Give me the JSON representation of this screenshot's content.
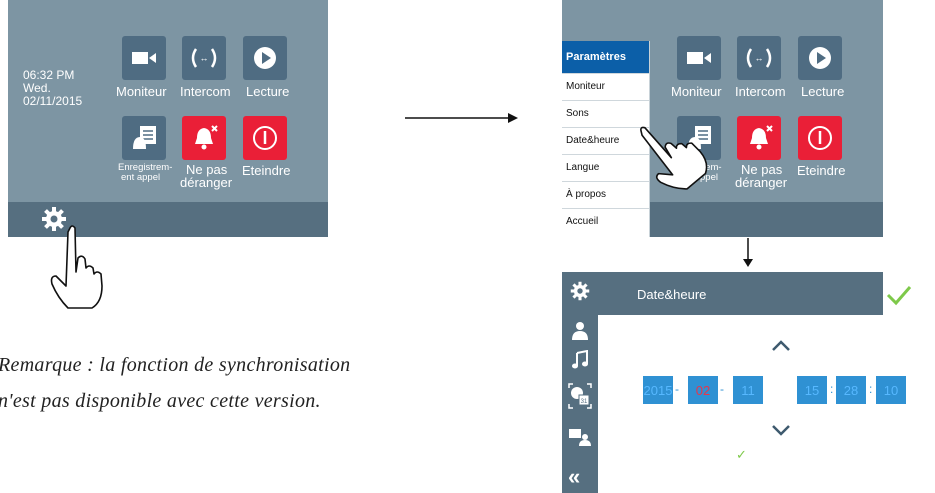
{
  "screen_left": {
    "time": "06:32 PM",
    "day": "Wed.",
    "date": "02/11/2015",
    "tiles": [
      {
        "label": "Moniteur",
        "icon": "video-camera-icon"
      },
      {
        "label": "Intercom",
        "icon": "intercom-icon"
      },
      {
        "label": "Lecture",
        "icon": "play-icon"
      },
      {
        "label_1": "Enregistrem-",
        "label_2": "ent appel",
        "icon": "call-recording-icon"
      },
      {
        "label_1": "Ne pas",
        "label_2": "déranger",
        "icon": "do-not-disturb-bell-icon"
      },
      {
        "label": "Eteindre",
        "icon": "power-icon"
      }
    ],
    "settings_icon": "gear-icon"
  },
  "screen_right_top": {
    "tiles": [
      {
        "label": "Moniteur"
      },
      {
        "label": "Intercom"
      },
      {
        "label": "Lecture"
      },
      {
        "label_1": "rem-",
        "label_2": "ppel"
      },
      {
        "label_1": "Ne pas",
        "label_2": "déranger"
      },
      {
        "label": "Eteindre"
      }
    ],
    "menu": {
      "title": "Paramètres",
      "items": [
        "Moniteur",
        "Sons",
        "Date&heure",
        "Langue",
        "À propos",
        "Accueil"
      ]
    }
  },
  "screen_date": {
    "header_title": "Date&heure",
    "year": "2015",
    "month": "02",
    "day": "11",
    "hour": "15",
    "minute": "28",
    "second": "10",
    "dash": "-",
    "colon": ":",
    "checkmark": "✓"
  },
  "note": {
    "line1": "Remarque : la fonction de synchronisation",
    "line2": "n'est pas disponible avec cette version."
  },
  "colors": {
    "screen_bg": "#7d95a3",
    "bar_bg": "#566f80",
    "tile": "#4f6c82",
    "tile_alert": "#ea1f37",
    "menu_header": "#0c5fa8",
    "date_box": "#2f91d3",
    "check": "#7ec94a"
  }
}
